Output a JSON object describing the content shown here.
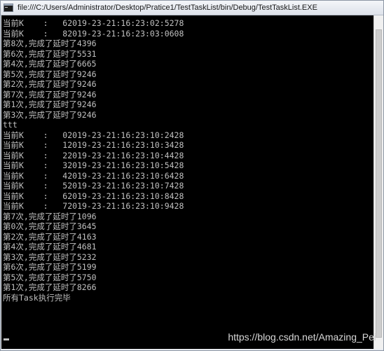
{
  "window": {
    "title": "file:///C:/Users/Administrator/Desktop/Pratice1/TestTaskList/bin/Debug/TestTaskList.EXE"
  },
  "console": {
    "lines": [
      "当前K    :   62019-23-21:16:23:02:5278",
      "当前K    :   82019-23-21:16:23:03:0608",
      "第8次,完成了延时了4396",
      "第6次,完成了延时了5531",
      "第4次,完成了延时了6665",
      "第5次,完成了延时了9246",
      "第2次,完成了延时了9246",
      "第7次,完成了延时了9246",
      "第1次,完成了延时了9246",
      "第3次,完成了延时了9246",
      "ttt",
      "当前K    :   02019-23-21:16:23:10:2428",
      "当前K    :   12019-23-21:16:23:10:3428",
      "当前K    :   22019-23-21:16:23:10:4428",
      "当前K    :   32019-23-21:16:23:10:5428",
      "当前K    :   42019-23-21:16:23:10:6428",
      "当前K    :   52019-23-21:16:23:10:7428",
      "当前K    :   62019-23-21:16:23:10:8428",
      "当前K    :   72019-23-21:16:23:10:9428",
      "第7次,完成了延时了1096",
      "第0次,完成了延时了3645",
      "第2次,完成了延时了4163",
      "第4次,完成了延时了4681",
      "第3次,完成了延时了5232",
      "第6次,完成了延时了5199",
      "第5次,完成了延时了5750",
      "第1次,完成了延时了8266",
      "所有Task执行完毕"
    ]
  },
  "watermark": "https://blog.csdn.net/Amazing_Pei",
  "colors": {
    "console_bg": "#000000",
    "console_text": "#c0c0c0",
    "titlebar_bg": "#e9ecf1"
  },
  "icons": {
    "app": "console-app-icon"
  }
}
